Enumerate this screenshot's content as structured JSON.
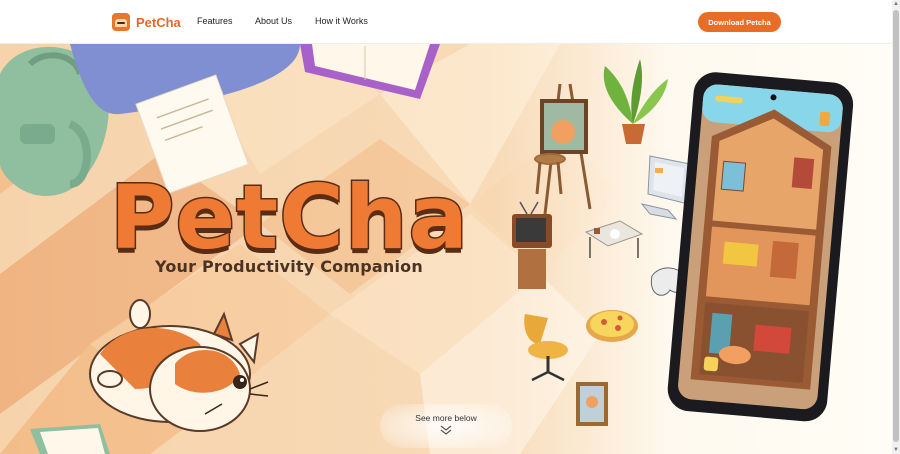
{
  "nav": {
    "brand_name": "PetCha",
    "links": [
      "Features",
      "About Us",
      "How it Works"
    ],
    "cta_label": "Download Petcha"
  },
  "hero": {
    "title": "PetCha",
    "subtitle": "Your Productivity Companion",
    "see_more": "See more below"
  },
  "colors": {
    "accent": "#e86d27",
    "title_fill": "#ee7a33",
    "title_outline": "#5a2c14",
    "background_cream": "#fbe8cf"
  },
  "icons": [
    "petcha-logo-icon",
    "chevron-double-down-icon"
  ]
}
